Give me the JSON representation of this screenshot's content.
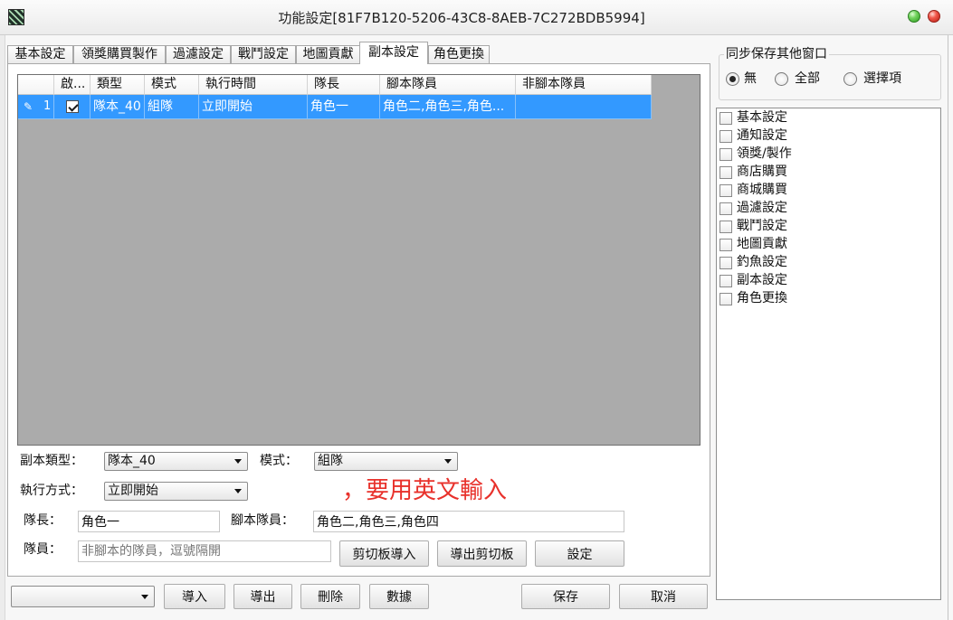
{
  "window": {
    "title": "功能設定[81F7B120-5206-43C8-8AEB-7C272BDB5994]"
  },
  "tabs": [
    {
      "label": "基本設定",
      "active": false
    },
    {
      "label": "領獎購買製作",
      "active": false
    },
    {
      "label": "過濾設定",
      "active": false
    },
    {
      "label": "戰鬥設定",
      "active": false
    },
    {
      "label": "地圖貢獻",
      "active": false
    },
    {
      "label": "副本設定",
      "active": true
    },
    {
      "label": "角色更換",
      "active": false
    }
  ],
  "grid": {
    "columns": [
      "啟...",
      "類型",
      "模式",
      "執行時間",
      "隊長",
      "腳本隊員",
      "非腳本隊員"
    ],
    "rows": [
      {
        "row_number": "1",
        "selected": true,
        "enabled": true,
        "type": "隊本_40",
        "mode": "組隊",
        "run_time": "立即開始",
        "leader": "角色一",
        "script_members": "角色二,角色三,角色...",
        "non_script_members": ""
      }
    ]
  },
  "form": {
    "dungeon_type": {
      "label": "副本類型：",
      "value": "隊本_40"
    },
    "mode": {
      "label": "模式：",
      "value": "組隊"
    },
    "run_method": {
      "label": "執行方式：",
      "value": "立即開始"
    },
    "hint": "，要用英文輸入",
    "leader": {
      "label": "隊長：",
      "value": "角色一"
    },
    "script_members": {
      "label": "腳本隊員：",
      "value": "角色二,角色三,角色四"
    },
    "members": {
      "label": "隊員：",
      "value": "",
      "placeholder": "非腳本的隊員，逗號隔開"
    },
    "buttons": {
      "import_clipboard": "剪切板導入",
      "export_clipboard": "導出剪切板",
      "set": "設定"
    }
  },
  "footer": {
    "profile_select": {
      "value": ""
    },
    "buttons": {
      "import": "導入",
      "export": "導出",
      "delete": "刪除",
      "data": "數據",
      "save": "保存",
      "cancel": "取消"
    }
  },
  "sync": {
    "title": "同步保存其他窗口",
    "options": [
      {
        "label": "無",
        "selected": true
      },
      {
        "label": "全部",
        "selected": false
      },
      {
        "label": "選擇項",
        "selected": false
      }
    ],
    "items": [
      {
        "label": "基本設定",
        "checked": false
      },
      {
        "label": "通知設定",
        "checked": false
      },
      {
        "label": "領獎/製作",
        "checked": false
      },
      {
        "label": "商店購買",
        "checked": false
      },
      {
        "label": "商城購買",
        "checked": false
      },
      {
        "label": "過濾設定",
        "checked": false
      },
      {
        "label": "戰鬥設定",
        "checked": false
      },
      {
        "label": "地圖貢獻",
        "checked": false
      },
      {
        "label": "釣魚設定",
        "checked": false
      },
      {
        "label": "副本設定",
        "checked": false
      },
      {
        "label": "角色更換",
        "checked": false
      }
    ]
  },
  "colors": {
    "selection": "#3399ff",
    "hint_text": "#e8312b",
    "grid_background": "#ababab",
    "window_button_green": "#3fae2e",
    "window_button_red": "#d9342a"
  },
  "icons": {
    "app": "app-icon",
    "row_edit": "pencil-icon",
    "dropdown": "chevron-down-icon",
    "minimize": "green-circle-icon",
    "close": "red-circle-icon"
  }
}
